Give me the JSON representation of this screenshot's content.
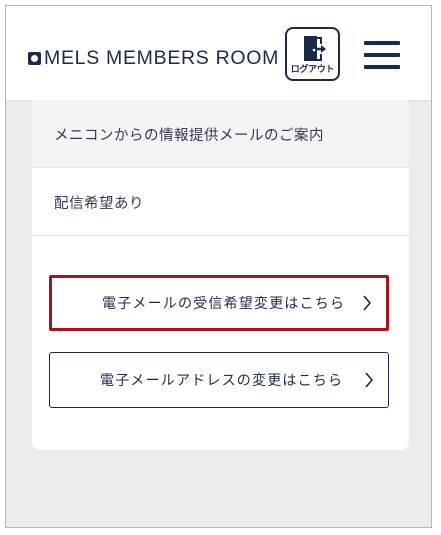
{
  "header": {
    "logo_text": "MELS MEMBERS ROOM",
    "logout_label": "ログアウト",
    "logout_icon": "door-exit-icon",
    "menu_icon": "hamburger-menu-icon"
  },
  "section": {
    "title": "メニコンからの情報提供メールのご案内",
    "value": "配信希望あり"
  },
  "actions": {
    "change_delivery_label": "電子メールの受信希望変更はこちら",
    "change_email_label": "電子メールアドレスの変更はこちら",
    "chevron_icon": "chevron-right-icon"
  },
  "colors": {
    "navy": "#1c2a4a",
    "highlight": "#a31520",
    "background": "#ebecf0"
  }
}
